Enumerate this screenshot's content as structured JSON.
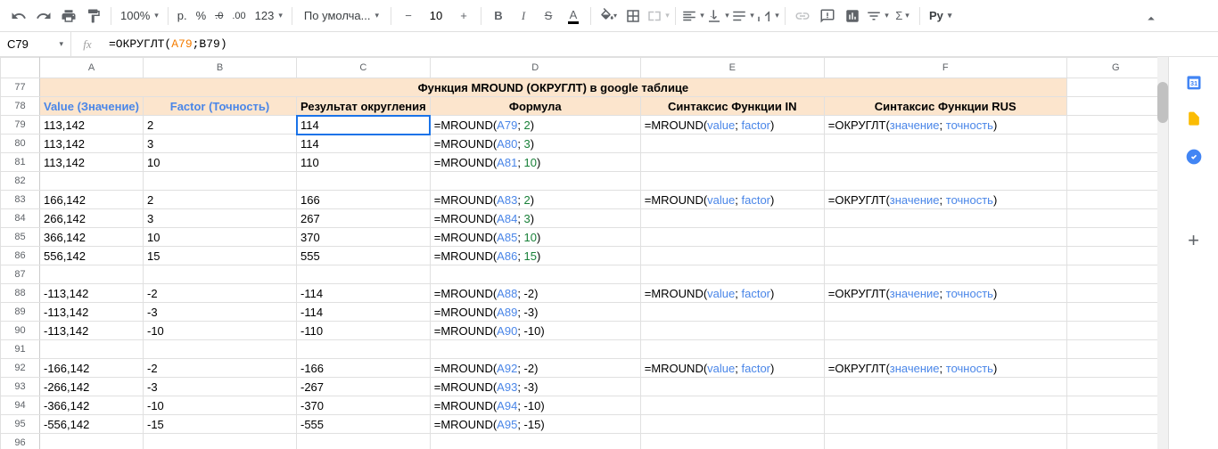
{
  "toolbar": {
    "zoom": "100%",
    "currency": "р.",
    "pct": "%",
    "dec_dec": ".0",
    "dec_inc": ".00",
    "more_fmt": "123",
    "font": "По умолча...",
    "size": "10",
    "py": "Py"
  },
  "namebox": "C79",
  "formula": {
    "pre": "=ОКРУГЛТ(",
    "r1": "A79",
    "mid": ";B79)"
  },
  "cols": [
    "A",
    "B",
    "C",
    "D",
    "E",
    "F",
    "G"
  ],
  "title_row": "77",
  "title": "Функция MROUND (ОКРУГЛТ) в google таблице",
  "hdr_row": "78",
  "headers": {
    "A": "Value (Значение)",
    "B": "Factor (Точность)",
    "C": "Результат округления",
    "D": "Формула",
    "E": "Синтаксис Функции IN",
    "F": "Синтаксис Функции RUS"
  },
  "rows": [
    {
      "n": "79",
      "A": "113,142",
      "B": "2",
      "C": "114",
      "D": {
        "p": "=MROUND(",
        "r": "A79",
        "m": "; ",
        "v": "2",
        "s": ")"
      },
      "E": {
        "p": "=MROUND(",
        "r": "value",
        "m": "; ",
        "v": "factor",
        "s": ")"
      },
      "F": {
        "p": "=ОКРУГЛТ(",
        "r": "значение",
        "m": "; ",
        "v": "точность",
        "s": ")"
      }
    },
    {
      "n": "80",
      "A": "113,142",
      "B": "3",
      "C": "114",
      "D": {
        "p": "=MROUND(",
        "r": "A80",
        "m": "; ",
        "v": "3",
        "s": ")"
      }
    },
    {
      "n": "81",
      "A": "113,142",
      "B": "10",
      "C": "110",
      "D": {
        "p": "=MROUND(",
        "r": "A81",
        "m": "; ",
        "v": "10",
        "s": ")"
      }
    },
    {
      "n": "82"
    },
    {
      "n": "83",
      "A": "166,142",
      "B": "2",
      "C": "166",
      "D": {
        "p": "=MROUND(",
        "r": "A83",
        "m": "; ",
        "v": "2",
        "s": ")"
      },
      "E": {
        "p": "=MROUND(",
        "r": "value",
        "m": "; ",
        "v": "factor",
        "s": ")"
      },
      "F": {
        "p": "=ОКРУГЛТ(",
        "r": "значение",
        "m": "; ",
        "v": "точность",
        "s": ")"
      }
    },
    {
      "n": "84",
      "A": "266,142",
      "B": "3",
      "C": "267",
      "D": {
        "p": "=MROUND(",
        "r": "A84",
        "m": "; ",
        "v": "3",
        "s": ")"
      }
    },
    {
      "n": "85",
      "A": "366,142",
      "B": "10",
      "C": "370",
      "D": {
        "p": "=MROUND(",
        "r": "A85",
        "m": "; ",
        "v": "10",
        "s": ")"
      }
    },
    {
      "n": "86",
      "A": "556,142",
      "B": "15",
      "C": "555",
      "D": {
        "p": "=MROUND(",
        "r": "A86",
        "m": "; ",
        "v": "15",
        "s": ")"
      }
    },
    {
      "n": "87"
    },
    {
      "n": "88",
      "A": "-113,142",
      "B": "-2",
      "C": "-114",
      "D": {
        "p": "=MROUND(",
        "r": "A88",
        "m": "; ",
        "v": "-2",
        "s": ")",
        "vplain": true
      },
      "E": {
        "p": "=MROUND(",
        "r": "value",
        "m": "; ",
        "v": "factor",
        "s": ")"
      },
      "F": {
        "p": "=ОКРУГЛТ(",
        "r": "значение",
        "m": "; ",
        "v": "точность",
        "s": ")"
      }
    },
    {
      "n": "89",
      "A": "-113,142",
      "B": "-3",
      "C": "-114",
      "D": {
        "p": "=MROUND(",
        "r": "A89",
        "m": "; ",
        "v": "-3",
        "s": ")",
        "vplain": true
      }
    },
    {
      "n": "90",
      "A": "-113,142",
      "B": "-10",
      "C": "-110",
      "D": {
        "p": "=MROUND(",
        "r": "A90",
        "m": "; ",
        "v": "-10",
        "s": ")",
        "vplain": true
      }
    },
    {
      "n": "91"
    },
    {
      "n": "92",
      "A": "-166,142",
      "B": "-2",
      "C": "-166",
      "D": {
        "p": "=MROUND(",
        "r": "A92",
        "m": "; ",
        "v": "-2",
        "s": ")",
        "vplain": true
      },
      "E": {
        "p": "=MROUND(",
        "r": "value",
        "m": "; ",
        "v": "factor",
        "s": ")"
      },
      "F": {
        "p": "=ОКРУГЛТ(",
        "r": "значение",
        "m": "; ",
        "v": "точность",
        "s": ")"
      }
    },
    {
      "n": "93",
      "A": "-266,142",
      "B": "-3",
      "C": "-267",
      "D": {
        "p": "=MROUND(",
        "r": "A93",
        "m": "; ",
        "v": "-3",
        "s": ")",
        "vplain": true
      }
    },
    {
      "n": "94",
      "A": "-366,142",
      "B": "-10",
      "C": "-370",
      "D": {
        "p": "=MROUND(",
        "r": "A94",
        "m": "; ",
        "v": "-10",
        "s": ")",
        "vplain": true
      }
    },
    {
      "n": "95",
      "A": "-556,142",
      "B": "-15",
      "C": "-555",
      "D": {
        "p": "=MROUND(",
        "r": "A95",
        "m": "; ",
        "v": "-15",
        "s": ")",
        "vplain": true
      }
    },
    {
      "n": "96"
    }
  ]
}
